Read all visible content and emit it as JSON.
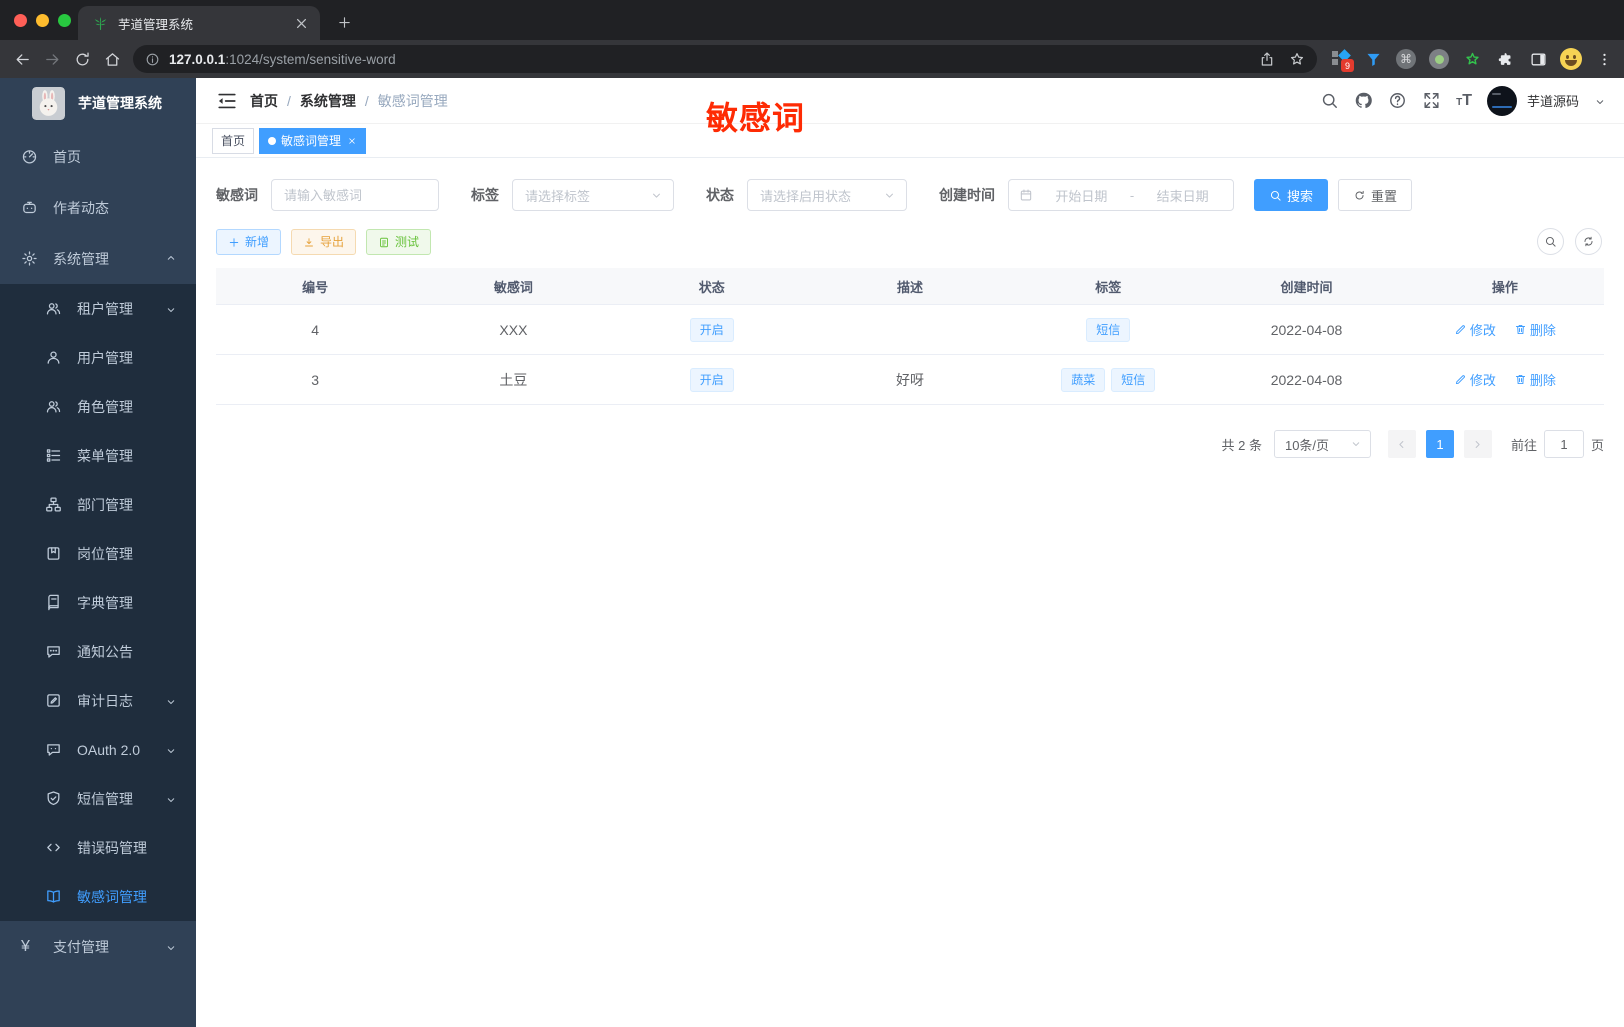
{
  "colors": {
    "accent": "#409eff",
    "sidebar_bg": "#304156",
    "submenu_bg": "#1f2d3d",
    "overlay_red": "#fe2b04",
    "tag_light_bg": "#ecf5ff"
  },
  "browser": {
    "tab_title": "芋道管理系统",
    "url_host": "127.0.0.1",
    "url_rest": ":1024/system/sensitive-word",
    "extensions": [
      {
        "name": "ext-grid",
        "badge": "9"
      },
      {
        "name": "funnel"
      },
      {
        "name": "command"
      },
      {
        "name": "record"
      },
      {
        "name": "green-star"
      },
      {
        "name": "puzzle"
      },
      {
        "name": "side-panel"
      },
      {
        "name": "profile-emoji"
      },
      {
        "name": "kebab"
      }
    ]
  },
  "sidebar": {
    "logo_text": "芋道管理系统",
    "items": [
      {
        "key": "home",
        "icon": "dashboard",
        "label": "首页"
      },
      {
        "key": "author-news",
        "icon": "robot",
        "label": "作者动态"
      },
      {
        "key": "system",
        "icon": "gear",
        "label": "系统管理",
        "arrow": "up"
      },
      {
        "key": "tenant",
        "icon": "users",
        "label": "租户管理",
        "sub": true,
        "arrow": "down"
      },
      {
        "key": "user",
        "icon": "user",
        "label": "用户管理",
        "sub": true
      },
      {
        "key": "role",
        "icon": "users",
        "label": "角色管理",
        "sub": true
      },
      {
        "key": "menu",
        "icon": "tree",
        "label": "菜单管理",
        "sub": true
      },
      {
        "key": "dept",
        "icon": "org",
        "label": "部门管理",
        "sub": true
      },
      {
        "key": "post",
        "icon": "badge",
        "label": "岗位管理",
        "sub": true
      },
      {
        "key": "dict",
        "icon": "book",
        "label": "字典管理",
        "sub": true
      },
      {
        "key": "notice",
        "icon": "comment",
        "label": "通知公告",
        "sub": true
      },
      {
        "key": "audit-log",
        "icon": "edit",
        "label": "审计日志",
        "sub": true,
        "arrow": "down"
      },
      {
        "key": "oauth",
        "icon": "chat",
        "label": "OAuth 2.0",
        "sub": true,
        "arrow": "down"
      },
      {
        "key": "sms",
        "icon": "shield",
        "label": "短信管理",
        "sub": true,
        "arrow": "down"
      },
      {
        "key": "error-code",
        "icon": "code",
        "label": "错误码管理",
        "sub": true
      },
      {
        "key": "sensitive-word",
        "icon": "openbook",
        "label": "敏感词管理",
        "sub": true,
        "active": true
      },
      {
        "key": "pay",
        "icon": "yen",
        "label": "支付管理",
        "arrow": "down"
      }
    ]
  },
  "header": {
    "breadcrumb": [
      "首页",
      "系统管理",
      "敏感词管理"
    ],
    "breadcrumb_separator": "/",
    "right_icons": [
      "search",
      "github",
      "help",
      "fullscreen",
      "font-size"
    ],
    "user_name": "芋道源码"
  },
  "overlay": {
    "text": "敏感词"
  },
  "tags": [
    {
      "label": "首页",
      "active": false
    },
    {
      "label": "敏感词管理",
      "active": true,
      "closable": true
    }
  ],
  "filters": {
    "fields": [
      {
        "label": "敏感词",
        "placeholder": "请输入敏感词"
      },
      {
        "label": "标签",
        "placeholder": "请选择标签"
      },
      {
        "label": "状态",
        "placeholder": "请选择启用状态"
      },
      {
        "label": "创建时间",
        "start_placeholder": "开始日期",
        "separator": "-",
        "end_placeholder": "结束日期"
      }
    ],
    "search_label": "搜索",
    "reset_label": "重置"
  },
  "actions": {
    "buttons": [
      {
        "label": "新增",
        "icon": "plus",
        "type": "primary"
      },
      {
        "label": "导出",
        "icon": "download",
        "type": "warning"
      },
      {
        "label": "测试",
        "icon": "doc",
        "type": "success"
      }
    ]
  },
  "table": {
    "columns": [
      "编号",
      "敏感词",
      "状态",
      "描述",
      "标签",
      "创建时间",
      "操作"
    ],
    "rows": [
      {
        "id": "4",
        "word": "XXX",
        "status": "开启",
        "desc": "",
        "tags": [
          "短信"
        ],
        "created": "2022-04-08"
      },
      {
        "id": "3",
        "word": "土豆",
        "status": "开启",
        "desc": "好呀",
        "tags": [
          "蔬菜",
          "短信"
        ],
        "created": "2022-04-08"
      }
    ],
    "ops": {
      "edit": "修改",
      "delete": "删除"
    }
  },
  "pagination": {
    "total": "共 2 条",
    "page_size": "10条/页",
    "pages": [
      "1"
    ],
    "current": "1",
    "goto_prefix": "前往",
    "goto_value": "1",
    "goto_suffix": "页"
  }
}
